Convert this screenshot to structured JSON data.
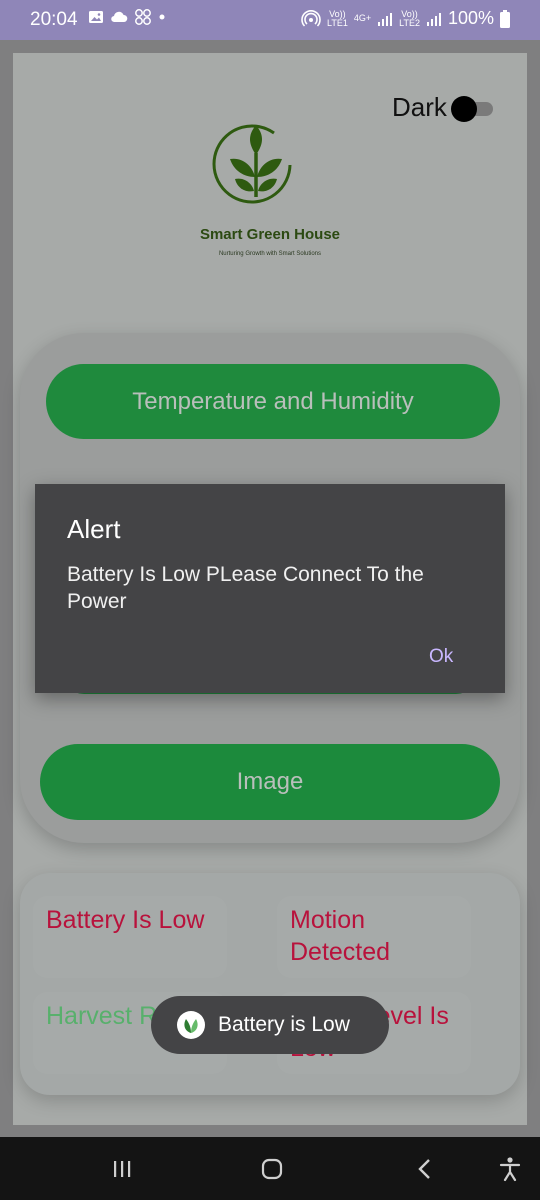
{
  "status_bar": {
    "time": "20:04",
    "battery_percent": "100%",
    "volte1": "Vo))",
    "lte1": "LTE1",
    "network_type": "4G+",
    "volte2": "Vo))",
    "lte2": "LTE2",
    "left_icons": [
      "image-icon",
      "cloud-icon",
      "grid-icon",
      "dot-icon"
    ],
    "right_icons": [
      "hotspot-icon",
      "signal-icon",
      "signal-icon",
      "battery-icon"
    ]
  },
  "header": {
    "dark_toggle_label": "Dark",
    "dark_toggle_on": false,
    "brand_title": "Smart Green House",
    "brand_subtitle": "Nurturing Growth with Smart Solutions"
  },
  "controls": {
    "temperature_button": "Temperature and Humidity",
    "image_button": "Image"
  },
  "status_tiles": [
    {
      "label": "Battery Is Low",
      "color": "#b8123c"
    },
    {
      "label": "Motion Detected",
      "color": "#b8123c"
    },
    {
      "label": "Harvest Ready",
      "color": "#58b06c"
    },
    {
      "label": "Water Level Is Low",
      "color": "#b8123c"
    }
  ],
  "dialog": {
    "title": "Alert",
    "message": "Battery Is Low PLease Connect To the Power",
    "ok_label": "Ok"
  },
  "toast": {
    "text": "Battery is Low"
  },
  "colors": {
    "accent_green": "#1f8a3d",
    "alert_red": "#b8123c",
    "dialog_bg": "#444446",
    "dialog_button": "#c9b7ff"
  },
  "nav_bar": {
    "items": [
      "recents-icon",
      "home-icon",
      "back-icon",
      "accessibility-icon"
    ]
  }
}
